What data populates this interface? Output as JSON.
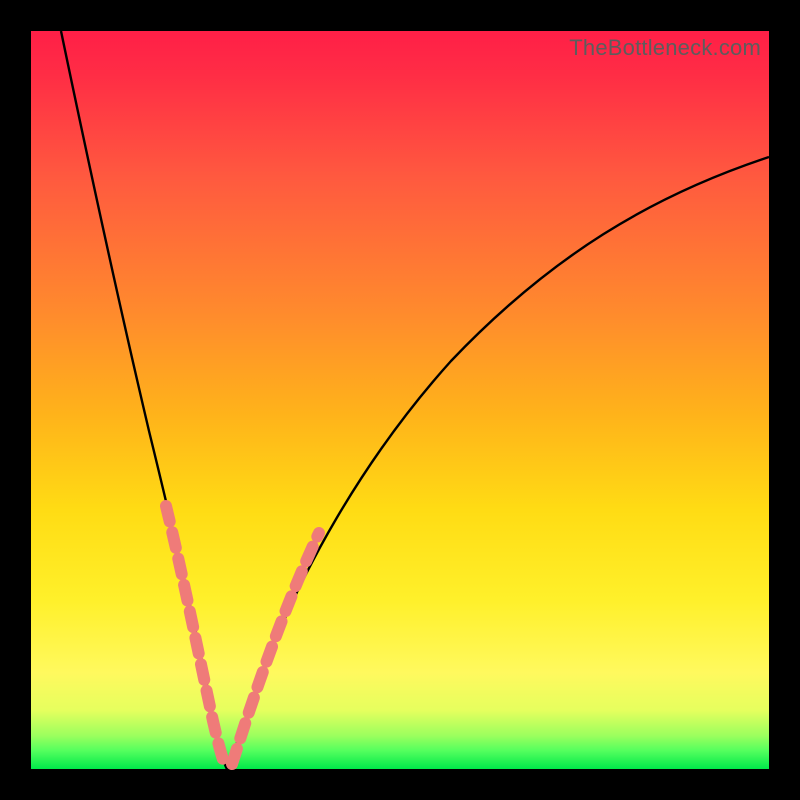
{
  "watermark": "TheBottleneck.com",
  "chart_data": {
    "type": "line",
    "title": "",
    "xlabel": "",
    "ylabel": "",
    "xlim": [
      0,
      100
    ],
    "ylim": [
      0,
      100
    ],
    "notes": "Bottleneck percentage vs. relative component performance. V-shaped curve: minimum (~0% bottleneck) near x≈26. Dotted salmon marker bands overlay the curve on each branch between roughly y≈8 and y≈32.",
    "series": [
      {
        "name": "bottleneck-curve-left",
        "x": [
          4,
          6,
          8,
          10,
          12,
          14,
          16,
          18,
          20,
          22,
          24,
          26
        ],
        "values": [
          100,
          88,
          77,
          67,
          58,
          50,
          42,
          35,
          27,
          19,
          10,
          0
        ]
      },
      {
        "name": "bottleneck-curve-right",
        "x": [
          26,
          28,
          31,
          34,
          38,
          43,
          50,
          58,
          66,
          74,
          82,
          90,
          98
        ],
        "values": [
          0,
          10,
          20,
          29,
          38,
          46,
          55,
          62,
          68,
          73,
          77,
          80,
          83
        ]
      }
    ],
    "marker_bands": [
      {
        "branch": "left",
        "y_from": 8,
        "y_to": 32
      },
      {
        "branch": "right",
        "y_from": 8,
        "y_to": 32
      }
    ],
    "colors": {
      "curve": "#000000",
      "markers": "#ef7b79",
      "background_gradient_top": "#ff1f47",
      "background_gradient_bottom": "#00e84a",
      "frame": "#000000",
      "watermark_text": "#5d5d5d"
    }
  }
}
